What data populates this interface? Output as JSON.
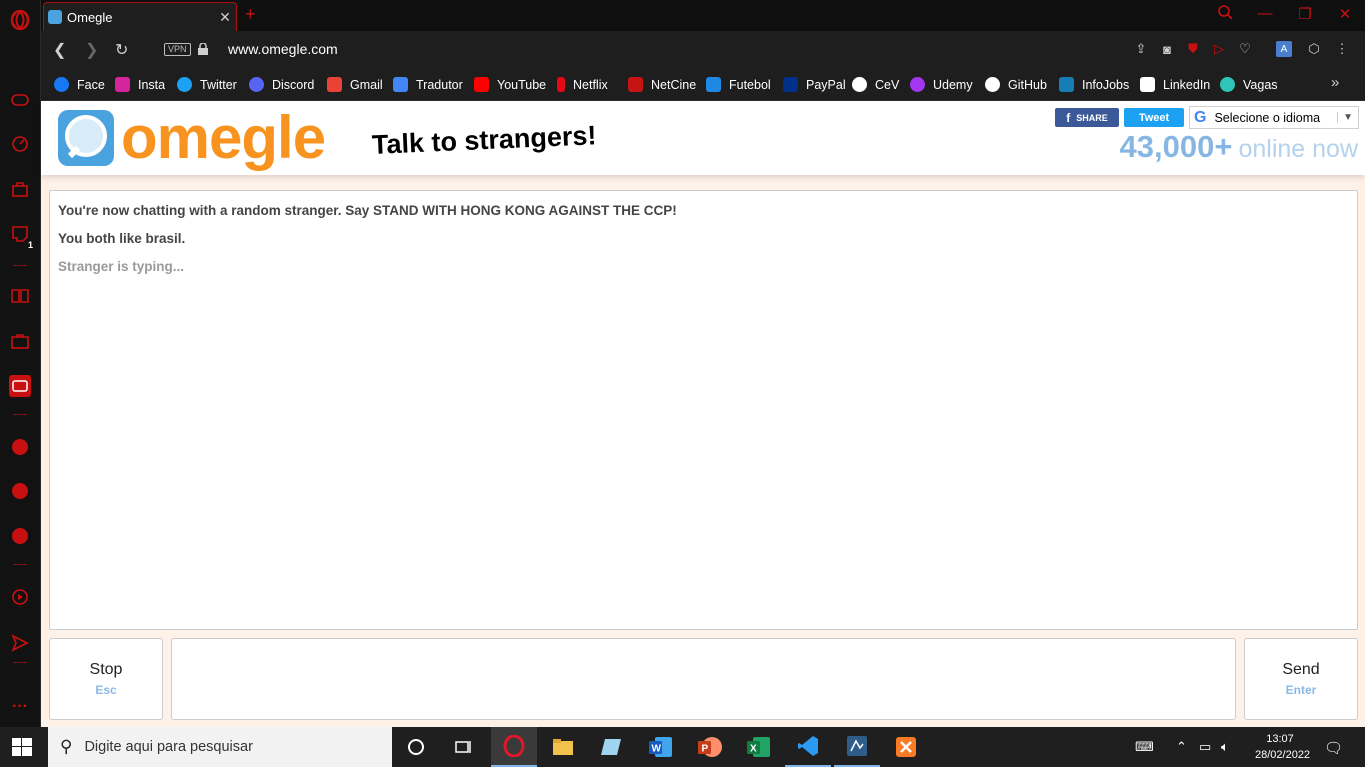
{
  "browser": {
    "tab_title": "Omegle",
    "url": "www.omegle.com",
    "vpn_label": "VPN",
    "sidebar_badge": "1"
  },
  "bookmarks": [
    {
      "label": "Face",
      "color": "#1877f2"
    },
    {
      "label": "Insta",
      "color": "#d6249f"
    },
    {
      "label": "Twitter",
      "color": "#1da1f2"
    },
    {
      "label": "Discord",
      "color": "#5865f2"
    },
    {
      "label": "Gmail",
      "color": "#ea4335"
    },
    {
      "label": "Tradutor",
      "color": "#4285f4"
    },
    {
      "label": "YouTube",
      "color": "#ff0000"
    },
    {
      "label": "Netflix",
      "color": "#e50914"
    },
    {
      "label": "NetCine",
      "color": "#c41414"
    },
    {
      "label": "Futebol",
      "color": "#1e88e5"
    },
    {
      "label": "PayPal",
      "color": "#003087"
    },
    {
      "label": "CeV",
      "color": "#ffffff"
    },
    {
      "label": "Udemy",
      "color": "#a435f0"
    },
    {
      "label": "GitHub",
      "color": "#ffffff"
    },
    {
      "label": "InfoJobs",
      "color": "#167db7"
    },
    {
      "label": "LinkedIn",
      "color": "#ffffff"
    },
    {
      "label": "Vagas",
      "color": "#2ec4b6"
    }
  ],
  "omegle": {
    "logo_text": "omegle",
    "tagline": "Talk to strangers!",
    "share_label": "SHARE",
    "tweet_label": "Tweet",
    "translate_label": "Selecione o idioma",
    "online_count": "43,000+",
    "online_label": "online now",
    "log": [
      "You're now chatting with a random stranger. Say STAND WITH HONG KONG AGAINST THE CCP!",
      "You both like brasil.",
      "Stranger is typing..."
    ],
    "stop_label": "Stop",
    "stop_key": "Esc",
    "send_label": "Send",
    "send_key": "Enter"
  },
  "taskbar": {
    "search_placeholder": "Digite aqui para pesquisar",
    "time": "13:07",
    "date": "28/02/2022"
  },
  "colors": {
    "opera_red": "#c81010",
    "omegle_orange": "#f7931e",
    "omegle_blue": "#86b6e3",
    "page_bg": "#fdf1e8"
  }
}
